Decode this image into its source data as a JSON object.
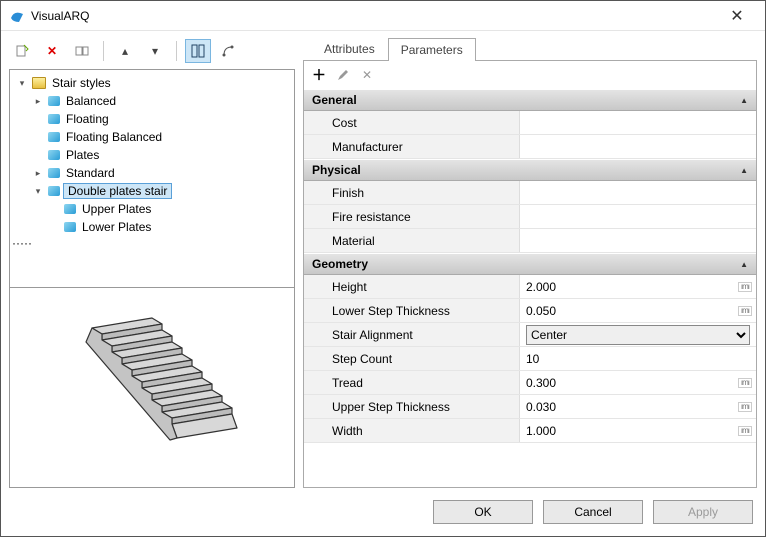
{
  "window": {
    "title": "VisualARQ"
  },
  "toolbar_left": {
    "new": "new",
    "delete": "delete",
    "rename": "rename",
    "up": "up",
    "down": "down",
    "mode_a": "mode-a",
    "mode_b": "mode-b"
  },
  "tree": {
    "root_label": "Stair styles",
    "items": [
      {
        "label": "Balanced"
      },
      {
        "label": "Floating"
      },
      {
        "label": "Floating Balanced"
      },
      {
        "label": "Plates"
      },
      {
        "label": "Standard"
      },
      {
        "label": "Double plates stair",
        "selected": true,
        "children": [
          {
            "label": "Upper Plates"
          },
          {
            "label": "Lower Plates"
          }
        ]
      }
    ]
  },
  "tabs": {
    "attributes": "Attributes",
    "parameters": "Parameters",
    "active": "parameters"
  },
  "param_toolbar": {
    "add": "add",
    "edit": "edit",
    "remove": "remove"
  },
  "sections": {
    "general": {
      "title": "General",
      "rows": [
        {
          "name": "Cost",
          "value": ""
        },
        {
          "name": "Manufacturer",
          "value": ""
        }
      ]
    },
    "physical": {
      "title": "Physical",
      "rows": [
        {
          "name": "Finish",
          "value": ""
        },
        {
          "name": "Fire resistance",
          "value": ""
        },
        {
          "name": "Material",
          "value": ""
        }
      ]
    },
    "geometry": {
      "title": "Geometry",
      "rows": [
        {
          "name": "Height",
          "value": "2.000",
          "unit": true
        },
        {
          "name": "Lower Step Thickness",
          "value": "0.050",
          "unit": true
        },
        {
          "name": "Stair Alignment",
          "value": "Center",
          "select": true
        },
        {
          "name": "Step Count",
          "value": "10"
        },
        {
          "name": "Tread",
          "value": "0.300",
          "unit": true
        },
        {
          "name": "Upper Step Thickness",
          "value": "0.030",
          "unit": true
        },
        {
          "name": "Width",
          "value": "1.000",
          "unit": true
        }
      ]
    }
  },
  "footer": {
    "ok": "OK",
    "cancel": "Cancel",
    "apply": "Apply"
  }
}
